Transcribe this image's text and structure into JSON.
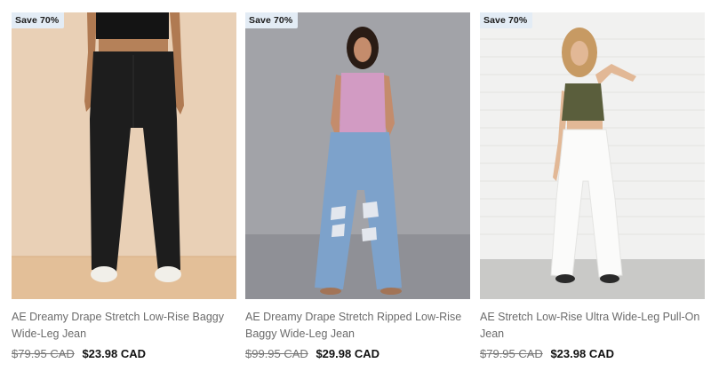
{
  "products": [
    {
      "badge": "Save 70%",
      "title": "AE Dreamy Drape Stretch Low-Rise Baggy Wide-Leg Jean",
      "was_price": "$79.95 CAD",
      "sale_price": "$23.98 CAD"
    },
    {
      "badge": "Save 70%",
      "title": "AE Dreamy Drape Stretch Ripped Low-Rise Baggy Wide-Leg Jean",
      "was_price": "$99.95 CAD",
      "sale_price": "$29.98 CAD"
    },
    {
      "badge": "Save 70%",
      "title": "AE Stretch Low-Rise Ultra Wide-Leg Pull-On Jean",
      "was_price": "$79.95 CAD",
      "sale_price": "$23.98 CAD"
    }
  ],
  "colors": {
    "badge_bg": "#e3ecf5",
    "title": "#6b6b6b",
    "price": "#111111",
    "was_price": "#757575"
  }
}
